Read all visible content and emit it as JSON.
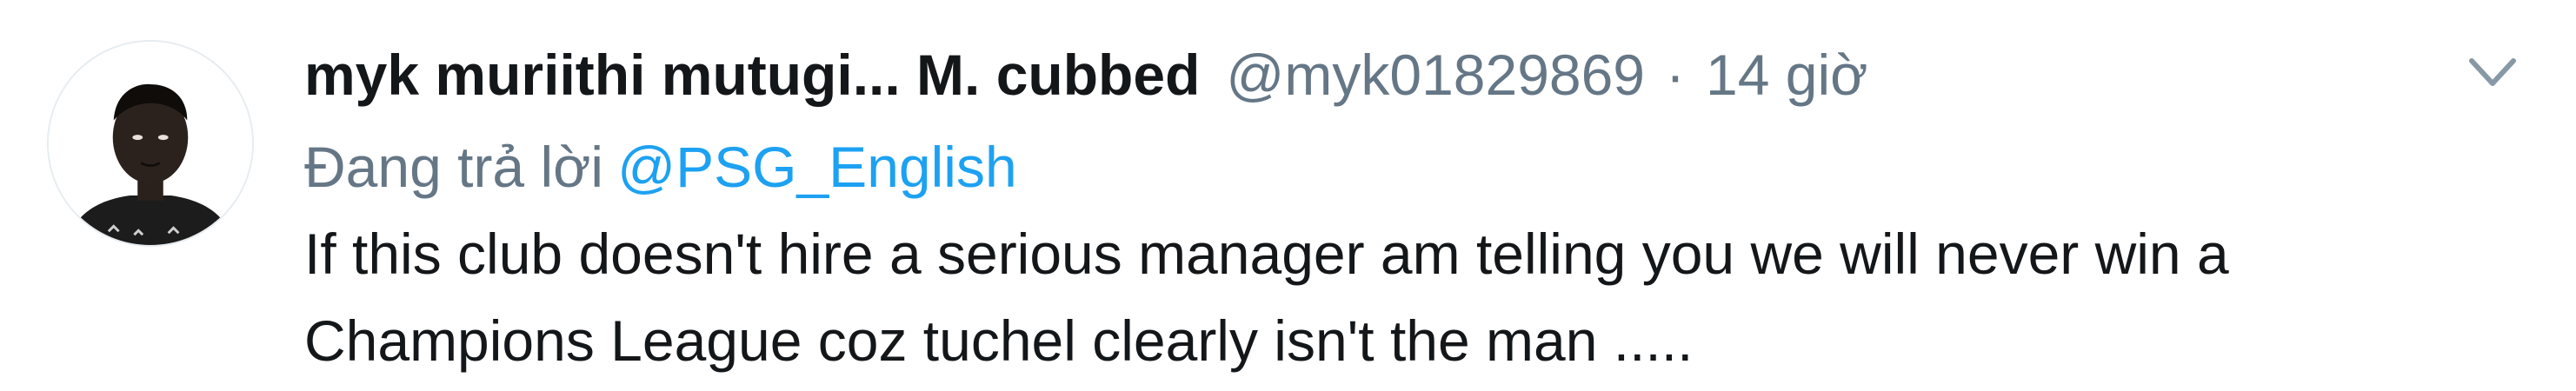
{
  "tweet": {
    "display_name": "myk muriithi mutugi... M. cubbed",
    "handle": "@myk01829869",
    "separator": "·",
    "time": "14 giờ",
    "reply_prefix": "Đang trả lời",
    "reply_to": "@PSG_English",
    "text": "If this club doesn't hire a serious manager am telling you we will never win a Champions League coz tuchel clearly isn't the man .....",
    "avatar_icon": "user-avatar-photo",
    "menu_icon": "chevron-down-icon"
  },
  "colors": {
    "text_primary": "#14171a",
    "text_secondary": "#657786",
    "link": "#1da1f2",
    "background": "#ffffff"
  }
}
